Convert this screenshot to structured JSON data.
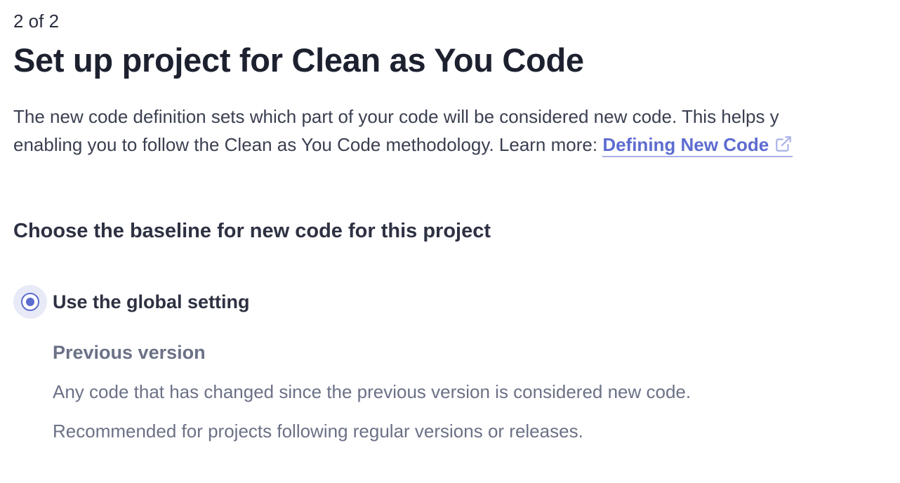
{
  "wizard": {
    "step": "2 of 2",
    "title": "Set up project for Clean as You Code"
  },
  "intro": {
    "line1": "The new code definition sets which part of your code will be considered new code. This helps y",
    "line2_prefix": "enabling you to follow the Clean as You Code methodology. Learn more: ",
    "link_label": "Defining New Code",
    "link_icon": "external-link-icon"
  },
  "baseline": {
    "heading": "Choose the baseline for new code for this project",
    "option": {
      "label": "Use the global setting",
      "selected": true,
      "setting_title": "Previous version",
      "setting_desc1": "Any code that has changed since the previous version is considered new code.",
      "setting_desc2": "Recommended for projects following regular versions or releases."
    }
  },
  "colors": {
    "accent": "#5d6cd0",
    "heading": "#1d212f",
    "muted": "#6b7186"
  }
}
